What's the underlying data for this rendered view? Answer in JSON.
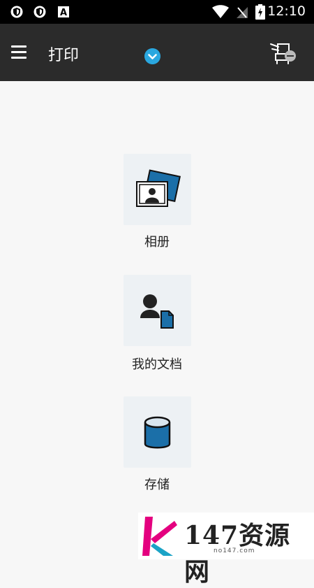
{
  "status_bar": {
    "time": "12:10",
    "icons": [
      "shield-icon",
      "shield-icon",
      "font-a-icon",
      "wifi-icon",
      "no-sim-icon",
      "battery-charging-icon"
    ]
  },
  "app_bar": {
    "title": "打印",
    "menu_icon": "hamburger-menu-icon",
    "dropdown_icon": "chevron-down-icon",
    "printer_icon": "printer-disconnected-icon",
    "accent_color": "#2aa7df",
    "background": "#2b2b2b"
  },
  "tiles": [
    {
      "label": "相册",
      "icon": "photo-album-icon"
    },
    {
      "label": "我的文档",
      "icon": "user-document-icon"
    },
    {
      "label": "存储",
      "icon": "storage-cylinder-icon"
    }
  ],
  "watermark": {
    "text": "147资源网",
    "sub": "no147.com"
  }
}
